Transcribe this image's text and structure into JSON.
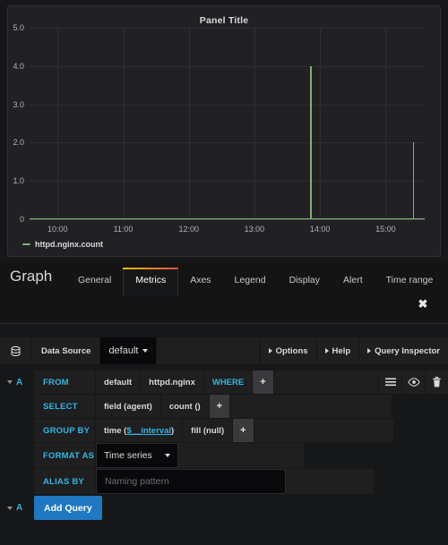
{
  "panel": {
    "title": "Panel Title",
    "legend": {
      "label": "httpd.nginx.count",
      "color": "#7eb26d"
    }
  },
  "chart_data": {
    "type": "line",
    "title": "Panel Title",
    "xlabel": "",
    "ylabel": "",
    "ylim": [
      0,
      5
    ],
    "yticks": [
      "0",
      "1.0",
      "2.0",
      "3.0",
      "4.0",
      "5.0"
    ],
    "ytick_values": [
      0,
      1,
      2,
      3,
      4,
      5
    ],
    "xticks": [
      "10:00",
      "11:00",
      "12:00",
      "13:00",
      "14:00",
      "15:00"
    ],
    "xlim": [
      "09:35",
      "15:35"
    ],
    "grid": true,
    "legend_position": "bottom-left",
    "series": [
      {
        "name": "httpd.nginx.count",
        "color": "#7eb26d",
        "points": [
          {
            "x": "09:35",
            "y": 0
          },
          {
            "x": "13:50",
            "y": 4
          },
          {
            "x": "15:25",
            "y": 2
          },
          {
            "x": "15:35",
            "y": 0
          }
        ],
        "spikes": [
          {
            "time": "13:50",
            "value": 4
          },
          {
            "time": "15:25",
            "value": 2
          }
        ],
        "baseline": 0
      }
    ]
  },
  "editor": {
    "heading": "Graph",
    "tabs": [
      {
        "label": "General",
        "active": false
      },
      {
        "label": "Metrics",
        "active": true
      },
      {
        "label": "Axes",
        "active": false
      },
      {
        "label": "Legend",
        "active": false
      },
      {
        "label": "Display",
        "active": false
      },
      {
        "label": "Alert",
        "active": false
      },
      {
        "label": "Time range",
        "active": false
      }
    ],
    "close_label": "✖"
  },
  "datasource_bar": {
    "icon": "database-icon",
    "label": "Data Source",
    "selected": "default",
    "buttons": [
      {
        "label": "Options"
      },
      {
        "label": "Help"
      },
      {
        "label": "Query Inspector"
      }
    ]
  },
  "query": {
    "ref_id": "A",
    "from": {
      "key": "FROM",
      "policy": "default",
      "measurement": "httpd.nginx",
      "where_keyword": "WHERE",
      "add": "+"
    },
    "select": {
      "key": "SELECT",
      "field": "field (agent)",
      "aggregate": "count ()",
      "add": "+"
    },
    "group_by": {
      "key": "GROUP BY",
      "time_prefix": "time (",
      "time_var": "$__interval",
      "time_suffix": ")",
      "fill": "fill (null)",
      "add": "+"
    },
    "format_as": {
      "key": "FORMAT AS",
      "value": "Time series"
    },
    "alias_by": {
      "key": "ALIAS BY",
      "value": "",
      "placeholder": "Naming pattern"
    },
    "row_actions": {
      "menu": "hamburger-icon",
      "toggle": "eye-icon",
      "remove": "trash-icon"
    }
  },
  "footer": {
    "ref_id": "A",
    "add_query_label": "Add Query"
  }
}
